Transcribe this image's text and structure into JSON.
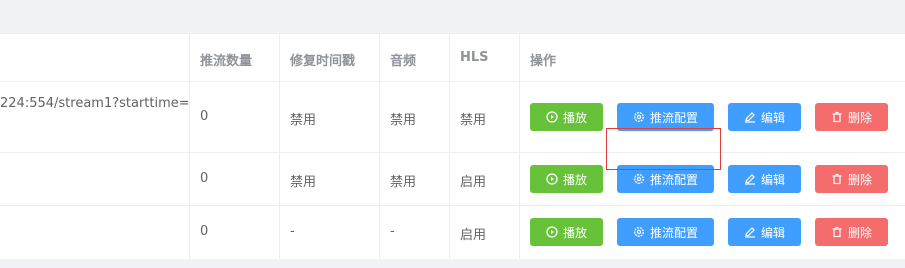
{
  "table": {
    "headers": {
      "push_count": "推流数量",
      "fix_timestamp": "修复时间戳",
      "audio": "音频",
      "hls": "HLS",
      "actions": "操作"
    },
    "rows": [
      {
        "url": "224:554/stream1?starttime=",
        "push_count": "0",
        "fix_timestamp": "禁用",
        "audio": "禁用",
        "hls": "禁用"
      },
      {
        "url": "",
        "push_count": "0",
        "fix_timestamp": "禁用",
        "audio": "禁用",
        "hls": "启用"
      },
      {
        "url": "",
        "push_count": "0",
        "fix_timestamp": "-",
        "audio": "-",
        "hls": "启用"
      }
    ],
    "actions": {
      "play": "播放",
      "push_config": "推流配置",
      "edit": "编辑",
      "delete": "删除"
    }
  },
  "colors": {
    "play": "#67c23a",
    "primary": "#409eff",
    "danger": "#f56c6c",
    "highlight": "#e03c3c"
  },
  "icons": [
    "play-circle-icon",
    "gear-icon",
    "edit-icon",
    "trash-icon"
  ]
}
